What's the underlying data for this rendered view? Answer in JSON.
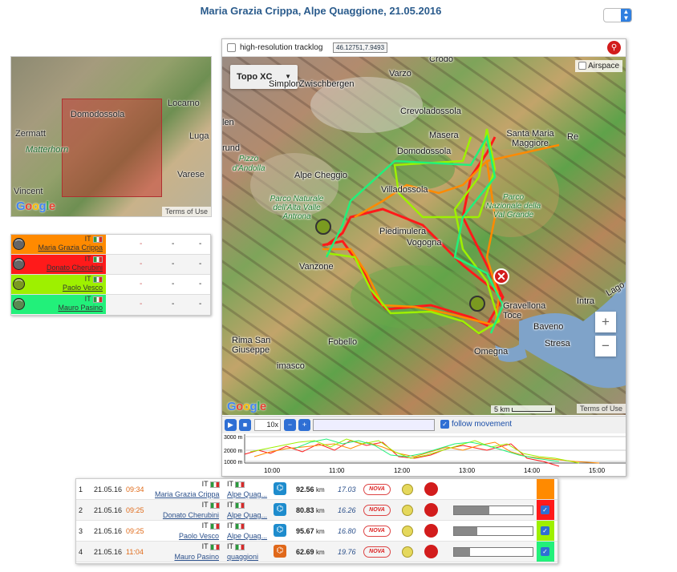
{
  "header": {
    "title": "Maria Grazia Crippa, Alpe Quaggione, 21.05.2016"
  },
  "overview_map": {
    "labels": [
      "Domodossola",
      "Locarno",
      "Zermatt",
      "Matterhorn",
      "Luga",
      "Varese",
      "Vincent"
    ],
    "google": "Google",
    "terms": "Terms of Use"
  },
  "legend": [
    {
      "nat": "IT",
      "name": "Maria Grazia Crippa",
      "color": "#ff8a00",
      "cells": [
        "-",
        "-",
        "-"
      ]
    },
    {
      "nat": "IT",
      "name": "Donato Cherubini",
      "color": "#ff1a1a",
      "cells": [
        "-",
        "-",
        "-"
      ]
    },
    {
      "nat": "IT",
      "name": "Paolo Vesco",
      "color": "#9ef000",
      "cells": [
        "-",
        "-",
        "-"
      ]
    },
    {
      "nat": "IT",
      "name": "Mauro Pasino",
      "color": "#22f07a",
      "cells": [
        "-",
        "-",
        "-"
      ]
    }
  ],
  "map": {
    "hires_label": "high-resolution tracklog",
    "coords": "46.12751,7.9493",
    "map_type": "Topo XC",
    "airspace": "Airspace",
    "places": [
      "Crodo",
      "Varzo",
      "Simplon",
      "Zwischbergen",
      "Crevoladossola",
      "Masera",
      "Santa Maria Maggiore",
      "Re",
      "Domodossola",
      "Pizzo d'Andolla",
      "Alpe Cheggio",
      "Villadossola",
      "Parco Naturale dell'Alta Valle Antrona",
      "Parco Nazionale della Val Grande",
      "Piedimulera",
      "Vogogna",
      "Vanzone",
      "Gravellona Toce",
      "Intra",
      "Baveno",
      "Rima San Giuseppe",
      "Fobello",
      "Stresa",
      "Omegna",
      "imasco",
      "len",
      "rund",
      "Lago"
    ],
    "zoom_in": "+",
    "zoom_out": "−",
    "scale": "5 km",
    "terms": "Terms of Use",
    "google": "Google"
  },
  "playback": {
    "speed": "10x",
    "follow": "follow movement"
  },
  "profile": {
    "y_ticks": [
      "3000 m",
      "2000 m",
      "1000 m"
    ],
    "x_ticks": [
      "10:00",
      "11:00",
      "12:00",
      "13:00",
      "14:00",
      "15:00"
    ]
  },
  "results": [
    {
      "rank": "1",
      "date": "21.05.16",
      "time": "09:34",
      "nat": "IT",
      "name": "Maria Grazia Crippa",
      "club_nat": "IT",
      "club": "Alpe Quag...",
      "km": "92.56",
      "unit": "km",
      "speed": "17.03",
      "brand": "NOVA",
      "fill": null,
      "color": "#ff8a00",
      "checked": false,
      "icon_color": "#1e8ccd"
    },
    {
      "rank": "2",
      "date": "21.05.16",
      "time": "09:25",
      "nat": "IT",
      "name": "Donato Cherubini",
      "club_nat": "IT",
      "club": "Alpe Quag...",
      "km": "80.83",
      "unit": "km",
      "speed": "16.26",
      "brand": "NOVA",
      "fill": 0.45,
      "color": "#ff1a1a",
      "checked": true,
      "icon_color": "#1e8ccd"
    },
    {
      "rank": "3",
      "date": "21.05.16",
      "time": "09:25",
      "nat": "IT",
      "name": "Paolo Vesco",
      "club_nat": "IT",
      "club": "Alpe Quag...",
      "km": "95.67",
      "unit": "km",
      "speed": "16.80",
      "brand": "NOVA",
      "fill": 0.3,
      "color": "#9ef000",
      "checked": true,
      "icon_color": "#1e8ccd"
    },
    {
      "rank": "4",
      "date": "21.05.16",
      "time": "11:04",
      "nat": "IT",
      "name": "Mauro Pasino",
      "club_nat": "IT",
      "club": "quaggioni",
      "km": "62.69",
      "unit": "km",
      "speed": "19.76",
      "brand": "NOVA",
      "fill": 0.2,
      "color": "#22f07a",
      "checked": true,
      "icon_color": "#e0681a"
    }
  ]
}
